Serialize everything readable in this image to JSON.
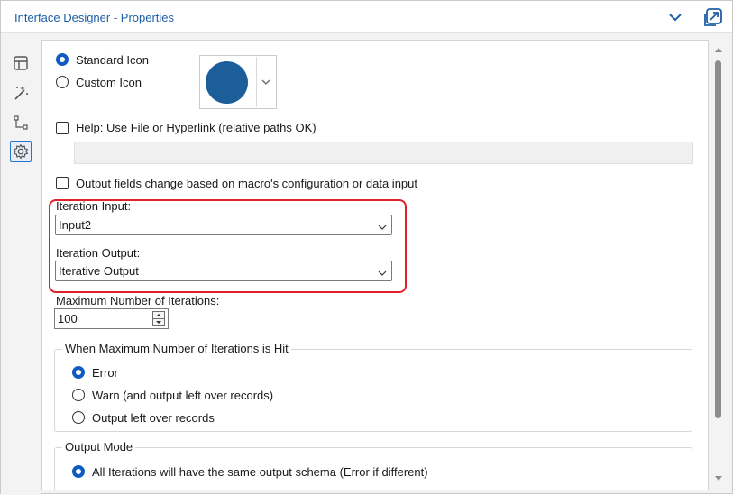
{
  "window": {
    "title": "Interface Designer - Properties"
  },
  "sidebar": {
    "items": [
      {
        "icon": "layout-icon"
      },
      {
        "icon": "magic-wand-icon"
      },
      {
        "icon": "tree-connector-icon"
      },
      {
        "icon": "gear-icon",
        "active": true
      }
    ]
  },
  "icon_section": {
    "standard_label": "Standard Icon",
    "custom_label": "Custom Icon",
    "selected": "Standard Icon",
    "icon_color": "#1b5e99"
  },
  "help": {
    "label": "Help: Use File or Hyperlink (relative paths OK)",
    "checked": false,
    "value": ""
  },
  "output_fields": {
    "label": "Output fields change based on macro's configuration or data input",
    "checked": false
  },
  "iteration": {
    "input_label": "Iteration Input:",
    "input_value": "Input2",
    "output_label": "Iteration Output:",
    "output_value": "Iterative Output",
    "highlight_color": "#e0202c"
  },
  "max_iterations": {
    "label": "Maximum Number of Iterations:",
    "value": "100"
  },
  "when_max_hit": {
    "legend": "When Maximum Number of Iterations is Hit",
    "options": [
      "Error",
      "Warn (and output left over records)",
      "Output left over records"
    ],
    "selected": "Error"
  },
  "output_mode": {
    "legend": "Output Mode",
    "options": [
      "All Iterations will have the same output schema (Error if different)"
    ],
    "selected": "All Iterations will have the same output schema (Error if different)"
  },
  "colors": {
    "accent": "#0f5cc0",
    "title": "#1f5fa8"
  }
}
